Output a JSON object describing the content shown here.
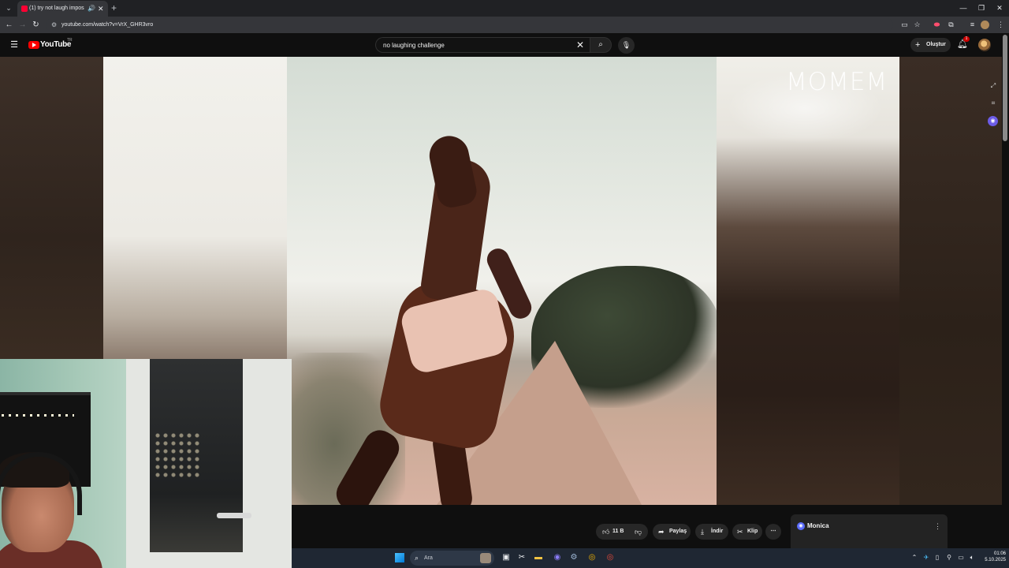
{
  "browser": {
    "tab": {
      "title": "(1) try not laugh impossib...",
      "audio_icon": "speaker-icon",
      "close_icon": "close-icon"
    },
    "new_tab_icon": "plus-icon",
    "url": "youtube.com/watch?v=VrX_GHR3vro",
    "window_controls": [
      "minimize-icon",
      "restore-icon",
      "close-icon"
    ]
  },
  "youtube": {
    "logo_text": "YouTube",
    "region": "TR",
    "search": {
      "query": "no laughing challenge",
      "clear_icon": "close-icon",
      "search_icon": "search-icon",
      "mic_icon": "mic-icon"
    },
    "create_label": "Oluştur",
    "notifications_count": "1",
    "colors": {
      "brand_red": "#ff0000",
      "background": "#0f0f0f",
      "pill": "#272727"
    }
  },
  "video": {
    "watermark": "MOMEM",
    "actions": {
      "like_count": "11 B",
      "share_label": "Paylaş",
      "download_label": "İndir",
      "clip_label": "Klip"
    }
  },
  "monica": {
    "name": "Monica"
  },
  "taskbar": {
    "search_placeholder": "Ara",
    "time": "01:06",
    "date": "5.10.2025"
  }
}
